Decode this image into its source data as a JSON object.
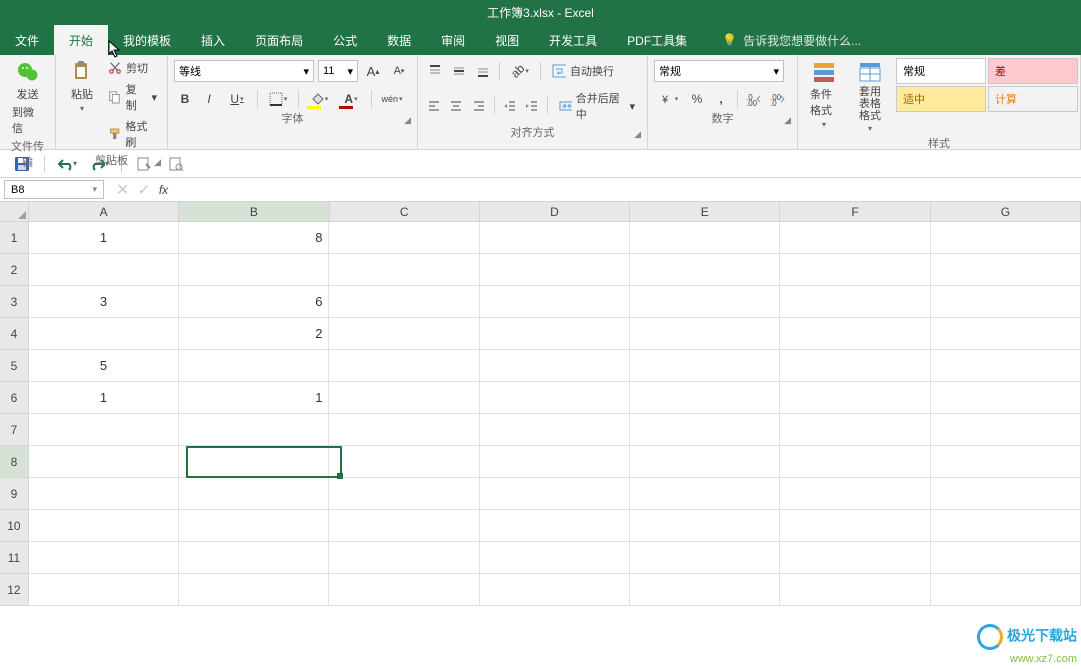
{
  "title": {
    "filename": "工作簿3.xlsx",
    "app": "Excel"
  },
  "tabs": {
    "file": "文件",
    "home": "开始",
    "template": "我的模板",
    "insert": "插入",
    "layout": "页面布局",
    "formula": "公式",
    "data": "数据",
    "review": "审阅",
    "view": "视图",
    "dev": "开发工具",
    "pdf": "PDF工具集",
    "tellme": "告诉我您想要做什么..."
  },
  "ribbon": {
    "wechat": {
      "line1": "发送",
      "line2": "到微信",
      "group": "文件传输"
    },
    "clipboard": {
      "paste": "粘贴",
      "cut": "剪切",
      "copy": "复制",
      "format_painter": "格式刷",
      "group": "剪贴板"
    },
    "font": {
      "name": "等线",
      "size": "11",
      "group": "字体",
      "bold": "B",
      "italic": "I",
      "underline": "U",
      "pinyin": "wén"
    },
    "align": {
      "wrap": "自动换行",
      "merge": "合并后居中",
      "group": "对齐方式"
    },
    "number": {
      "format": "常规",
      "group": "数字"
    },
    "styles": {
      "cond": "条件格式",
      "table": "套用\n表格格式",
      "normal": "常规",
      "good": "适中",
      "bad": "差",
      "calc": "计算",
      "group": "样式"
    }
  },
  "namebox": "B8",
  "columns": [
    "A",
    "B",
    "C",
    "D",
    "E",
    "F",
    "G"
  ],
  "rows": [
    "1",
    "2",
    "3",
    "4",
    "5",
    "6",
    "7",
    "8",
    "9",
    "10",
    "11",
    "12"
  ],
  "cells": {
    "A1": "1",
    "B1": "8",
    "A3": "3",
    "B3": "6",
    "B4": "2",
    "A5": "5",
    "A6": "1",
    "B6": "1"
  },
  "fx_placeholder": "",
  "watermark": {
    "cn": "极光下载站",
    "en": "www.xz7.com"
  }
}
